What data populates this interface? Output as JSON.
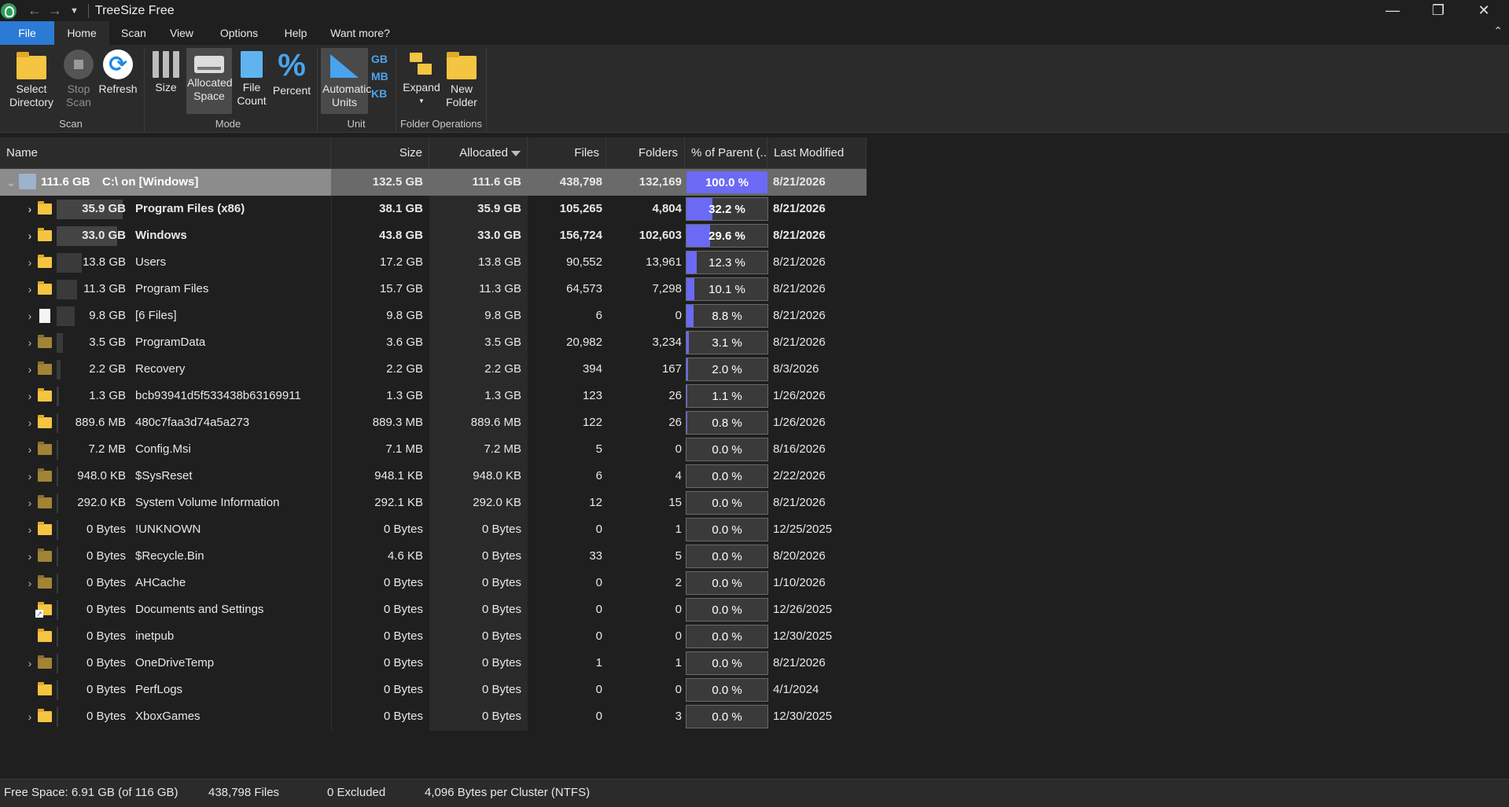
{
  "window": {
    "title": "TreeSize Free",
    "minimize": "—",
    "restore": "❐",
    "close": "✕"
  },
  "menu": {
    "tabs": [
      "File",
      "Home",
      "Scan",
      "View",
      "Options",
      "Help",
      "Want more?"
    ],
    "collapse": "⌃"
  },
  "ribbon": {
    "select_directory": "Select Directory",
    "stop_scan": "Stop Scan",
    "refresh": "Refresh",
    "size": "Size",
    "allocated_space": "Allocated Space",
    "file_count": "File Count",
    "percent": "Percent",
    "automatic_units": "Automatic Units",
    "units": [
      "GB",
      "MB",
      "KB"
    ],
    "expand": "Expand",
    "new_folder": "New Folder",
    "groups": [
      "Scan",
      "Mode",
      "Unit",
      "Folder Operations"
    ]
  },
  "table": {
    "columns": [
      "Name",
      "Size",
      "Allocated",
      "Files",
      "Folders",
      "% of Parent (...",
      "Last Modified"
    ],
    "sort_column": "Allocated",
    "rows": [
      {
        "alloc_label": "111.6 GB",
        "name": "C:\\  on  [Windows]",
        "size": "132.5 GB",
        "allocated": "111.6 GB",
        "files": "438,798",
        "folders": "132,169",
        "percent": "100.0 %",
        "percent_value": 100.0,
        "modified": "8/21/2026",
        "icon": "drive-icon",
        "expandable": "expanded",
        "bold": true,
        "selected": true
      },
      {
        "alloc_label": "35.9 GB",
        "name": "Program Files (x86)",
        "size": "38.1 GB",
        "allocated": "35.9 GB",
        "files": "105,265",
        "folders": "4,804",
        "percent": "32.2 %",
        "percent_value": 32.2,
        "modified": "8/21/2026",
        "icon": "folder-icon",
        "expandable": "collapsed",
        "bold": true
      },
      {
        "alloc_label": "33.0 GB",
        "name": "Windows",
        "size": "43.8 GB",
        "allocated": "33.0 GB",
        "files": "156,724",
        "folders": "102,603",
        "percent": "29.6 %",
        "percent_value": 29.6,
        "modified": "8/21/2026",
        "icon": "folder-icon",
        "expandable": "collapsed",
        "bold": true
      },
      {
        "alloc_label": "13.8 GB",
        "name": "Users",
        "size": "17.2 GB",
        "allocated": "13.8 GB",
        "files": "90,552",
        "folders": "13,961",
        "percent": "12.3 %",
        "percent_value": 12.3,
        "modified": "8/21/2026",
        "icon": "folder-icon",
        "expandable": "collapsed"
      },
      {
        "alloc_label": "11.3 GB",
        "name": "Program Files",
        "size": "15.7 GB",
        "allocated": "11.3 GB",
        "files": "64,573",
        "folders": "7,298",
        "percent": "10.1 %",
        "percent_value": 10.1,
        "modified": "8/21/2026",
        "icon": "folder-icon",
        "expandable": "collapsed"
      },
      {
        "alloc_label": "9.8 GB",
        "name": "[6 Files]",
        "size": "9.8 GB",
        "allocated": "9.8 GB",
        "files": "6",
        "folders": "0",
        "percent": "8.8 %",
        "percent_value": 8.8,
        "modified": "8/21/2026",
        "icon": "file-icon",
        "expandable": "collapsed"
      },
      {
        "alloc_label": "3.5 GB",
        "name": "ProgramData",
        "size": "3.6 GB",
        "allocated": "3.5 GB",
        "files": "20,982",
        "folders": "3,234",
        "percent": "3.1 %",
        "percent_value": 3.1,
        "modified": "8/21/2026",
        "icon": "folder-dark-icon",
        "expandable": "collapsed"
      },
      {
        "alloc_label": "2.2 GB",
        "name": "Recovery",
        "size": "2.2 GB",
        "allocated": "2.2 GB",
        "files": "394",
        "folders": "167",
        "percent": "2.0 %",
        "percent_value": 2.0,
        "modified": "8/3/2026",
        "icon": "folder-dark-icon",
        "expandable": "collapsed"
      },
      {
        "alloc_label": "1.3 GB",
        "name": "bcb93941d5f533438b63169911",
        "size": "1.3 GB",
        "allocated": "1.3 GB",
        "files": "123",
        "folders": "26",
        "percent": "1.1 %",
        "percent_value": 1.1,
        "modified": "1/26/2026",
        "icon": "folder-icon",
        "expandable": "collapsed"
      },
      {
        "alloc_label": "889.6 MB",
        "name": "480c7faa3d74a5a273",
        "size": "889.3 MB",
        "allocated": "889.6 MB",
        "files": "122",
        "folders": "26",
        "percent": "0.8 %",
        "percent_value": 0.8,
        "modified": "1/26/2026",
        "icon": "folder-icon",
        "expandable": "collapsed"
      },
      {
        "alloc_label": "7.2 MB",
        "name": "Config.Msi",
        "size": "7.1 MB",
        "allocated": "7.2 MB",
        "files": "5",
        "folders": "0",
        "percent": "0.0 %",
        "percent_value": 0.0,
        "modified": "8/16/2026",
        "icon": "folder-dark-icon",
        "expandable": "collapsed"
      },
      {
        "alloc_label": "948.0 KB",
        "name": "$SysReset",
        "size": "948.1 KB",
        "allocated": "948.0 KB",
        "files": "6",
        "folders": "4",
        "percent": "0.0 %",
        "percent_value": 0.0,
        "modified": "2/22/2026",
        "icon": "folder-dark-icon",
        "expandable": "collapsed"
      },
      {
        "alloc_label": "292.0 KB",
        "name": "System Volume Information",
        "size": "292.1 KB",
        "allocated": "292.0 KB",
        "files": "12",
        "folders": "15",
        "percent": "0.0 %",
        "percent_value": 0.0,
        "modified": "8/21/2026",
        "icon": "folder-dark-icon",
        "expandable": "collapsed"
      },
      {
        "alloc_label": "0 Bytes",
        "name": "!UNKNOWN",
        "size": "0 Bytes",
        "allocated": "0 Bytes",
        "files": "0",
        "folders": "1",
        "percent": "0.0 %",
        "percent_value": 0.0,
        "modified": "12/25/2025",
        "icon": "folder-icon",
        "expandable": "collapsed"
      },
      {
        "alloc_label": "0 Bytes",
        "name": "$Recycle.Bin",
        "size": "4.6 KB",
        "allocated": "0 Bytes",
        "files": "33",
        "folders": "5",
        "percent": "0.0 %",
        "percent_value": 0.0,
        "modified": "8/20/2026",
        "icon": "folder-dark-icon",
        "expandable": "collapsed"
      },
      {
        "alloc_label": "0 Bytes",
        "name": "AHCache",
        "size": "0 Bytes",
        "allocated": "0 Bytes",
        "files": "0",
        "folders": "2",
        "percent": "0.0 %",
        "percent_value": 0.0,
        "modified": "1/10/2026",
        "icon": "folder-dark-icon",
        "expandable": "collapsed"
      },
      {
        "alloc_label": "0 Bytes",
        "name": "Documents and Settings",
        "size": "0 Bytes",
        "allocated": "0 Bytes",
        "files": "0",
        "folders": "0",
        "percent": "0.0 %",
        "percent_value": 0.0,
        "modified": "12/26/2025",
        "icon": "folder-link-icon",
        "expandable": "none"
      },
      {
        "alloc_label": "0 Bytes",
        "name": "inetpub",
        "size": "0 Bytes",
        "allocated": "0 Bytes",
        "files": "0",
        "folders": "0",
        "percent": "0.0 %",
        "percent_value": 0.0,
        "modified": "12/30/2025",
        "icon": "folder-icon",
        "expandable": "none"
      },
      {
        "alloc_label": "0 Bytes",
        "name": "OneDriveTemp",
        "size": "0 Bytes",
        "allocated": "0 Bytes",
        "files": "1",
        "folders": "1",
        "percent": "0.0 %",
        "percent_value": 0.0,
        "modified": "8/21/2026",
        "icon": "folder-dark-icon",
        "expandable": "collapsed"
      },
      {
        "alloc_label": "0 Bytes",
        "name": "PerfLogs",
        "size": "0 Bytes",
        "allocated": "0 Bytes",
        "files": "0",
        "folders": "0",
        "percent": "0.0 %",
        "percent_value": 0.0,
        "modified": "4/1/2024",
        "icon": "folder-icon",
        "expandable": "none"
      },
      {
        "alloc_label": "0 Bytes",
        "name": "XboxGames",
        "size": "0 Bytes",
        "allocated": "0 Bytes",
        "files": "0",
        "folders": "3",
        "percent": "0.0 %",
        "percent_value": 0.0,
        "modified": "12/30/2025",
        "icon": "folder-icon",
        "expandable": "collapsed"
      }
    ]
  },
  "status": {
    "free_space": "Free Space: 6.91 GB  (of 116 GB)",
    "files": "438,798 Files",
    "excluded": "0 Excluded",
    "cluster": "4,096 Bytes per Cluster (NTFS)"
  },
  "colors": {
    "accent": "#2a7ad6",
    "percent_bar": "#6a6af5",
    "folder": "#f5c542"
  }
}
